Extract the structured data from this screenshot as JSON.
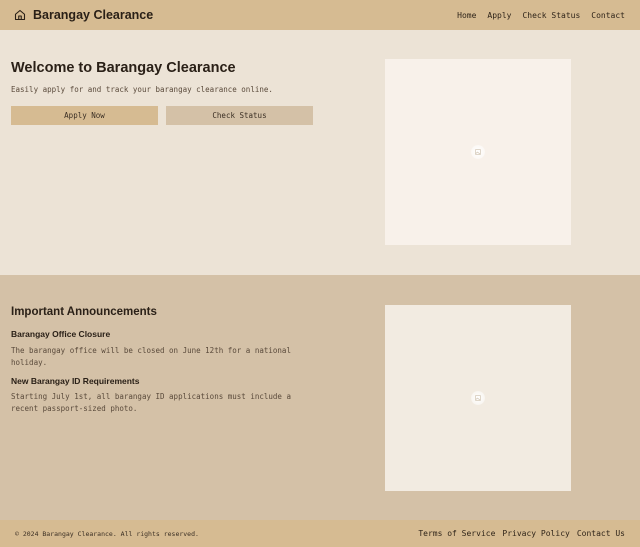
{
  "header": {
    "brand_icon": "home-icon",
    "brand_title": "Barangay Clearance",
    "nav": [
      "Home",
      "Apply",
      "Check Status",
      "Contact"
    ]
  },
  "hero": {
    "title": "Welcome to Barangay Clearance",
    "subtitle": "Easily apply for and track your barangay clearance online.",
    "apply_label": "Apply Now",
    "check_label": "Check Status",
    "image_icon": "image-placeholder-icon"
  },
  "announcements": {
    "title": "Important Announcements",
    "items": [
      {
        "title": "Barangay Office Closure",
        "body": "The barangay office will be closed on June 12th for a national holiday."
      },
      {
        "title": "New Barangay ID Requirements",
        "body": "Starting July 1st, all barangay ID applications must include a recent passport-sized photo."
      }
    ],
    "image_icon": "image-placeholder-icon"
  },
  "footer": {
    "copyright": "© 2024 Barangay Clearance. All rights reserved.",
    "links": [
      "Terms of Service",
      "Privacy Policy",
      "Contact Us"
    ]
  },
  "colors": {
    "header_bg": "#d6bb92",
    "hero_bg": "#ece3d6",
    "announcements_bg": "#d4c1a7",
    "primary_button": "#d6bb92",
    "secondary_button": "#d4c1a7",
    "text_dark": "#2a2017"
  }
}
